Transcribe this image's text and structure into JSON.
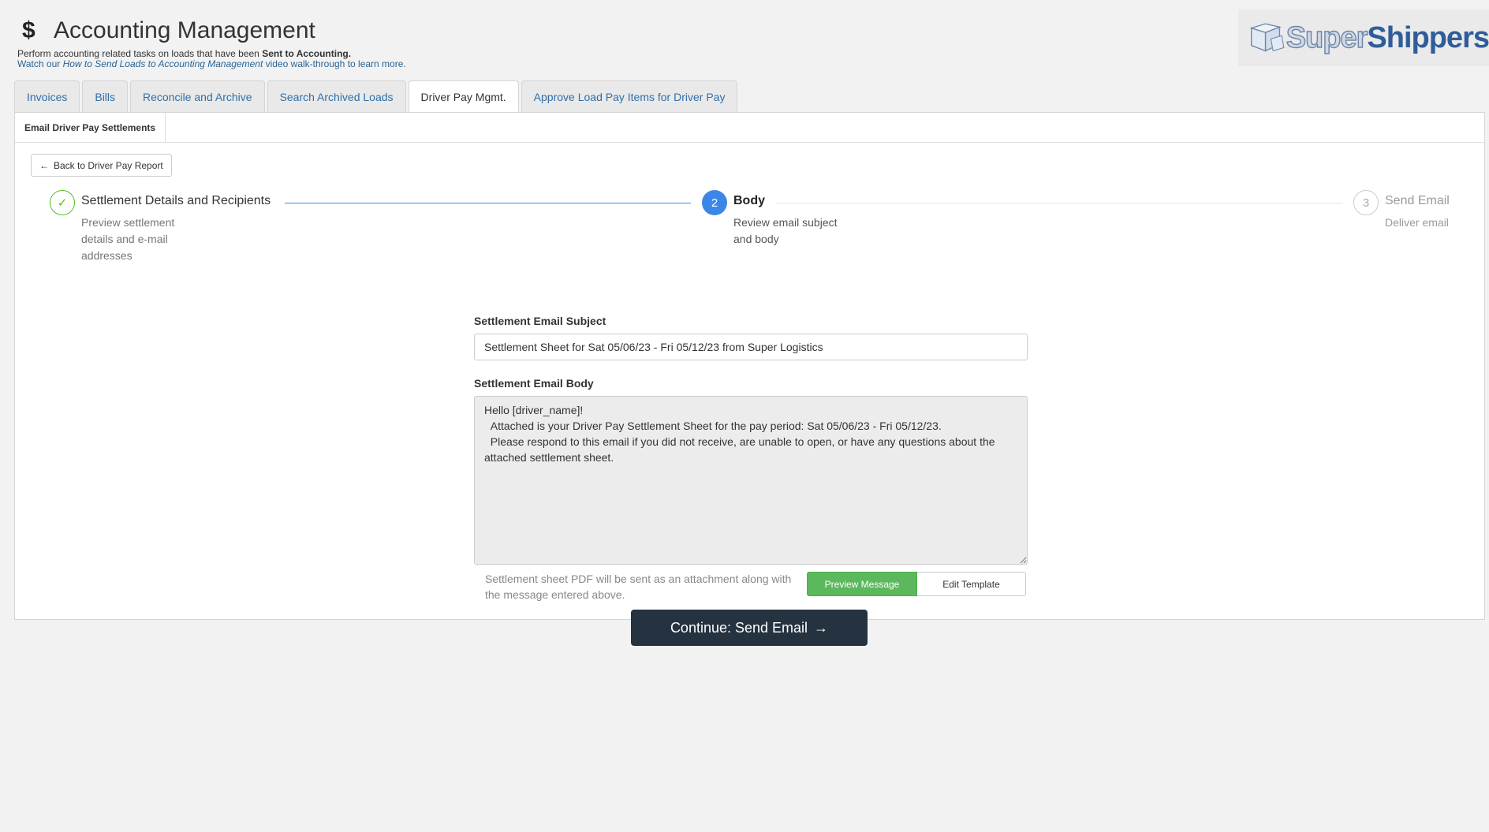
{
  "header": {
    "title": "Accounting Management",
    "subtitle_prefix": "Perform accounting related tasks on loads that have been ",
    "subtitle_bold": "Sent to Accounting.",
    "watch_prefix": "Watch our ",
    "watch_link": "How to Send Loads to Accounting Management",
    "watch_suffix": " video walk-through to learn more.",
    "logo_super": "Super",
    "logo_shippers": "Shippers"
  },
  "tabs": [
    {
      "label": "Invoices"
    },
    {
      "label": "Bills"
    },
    {
      "label": "Reconcile and Archive"
    },
    {
      "label": "Search Archived Loads"
    },
    {
      "label": "Driver Pay Mgmt."
    },
    {
      "label": "Approve Load Pay Items for Driver Pay"
    }
  ],
  "subtab": {
    "label": "Email Driver Pay Settlements"
  },
  "back_button": {
    "label": "Back to Driver Pay Report"
  },
  "steps": [
    {
      "number": "",
      "title": "Settlement Details and Recipients",
      "desc_lines": [
        "Preview settlement",
        "details and e-mail",
        "addresses"
      ]
    },
    {
      "number": "2",
      "title": "Body",
      "desc_lines": [
        "Review email subject",
        "and body"
      ]
    },
    {
      "number": "3",
      "title": "Send Email",
      "desc_lines": [
        "Deliver email"
      ]
    }
  ],
  "form": {
    "subject_label": "Settlement Email Subject",
    "subject_value": "Settlement Sheet for Sat 05/06/23 - Fri 05/12/23 from Super Logistics",
    "body_label": "Settlement Email Body",
    "body_value": "Hello [driver_name]!\n  Attached is your Driver Pay Settlement Sheet for the pay period: Sat 05/06/23 - Fri 05/12/23.\n  Please respond to this email if you did not receive, are unable to open, or have any questions about the attached settlement sheet.",
    "hint": "Settlement sheet PDF will be sent as an attachment along with the message entered above.",
    "preview_button": "Preview Message",
    "edit_button": "Edit Template",
    "continue_button": "Continue: Send Email"
  },
  "colors": {
    "step_done": "#52c41a",
    "step_active": "#3b87e8",
    "continue_bg": "#253341",
    "preview_bg": "#5cb85c",
    "tab_link": "#2f6fa8"
  },
  "icons": {
    "dollar": "$",
    "check": "✓",
    "arrow_left": "←",
    "arrow_right": "→"
  }
}
